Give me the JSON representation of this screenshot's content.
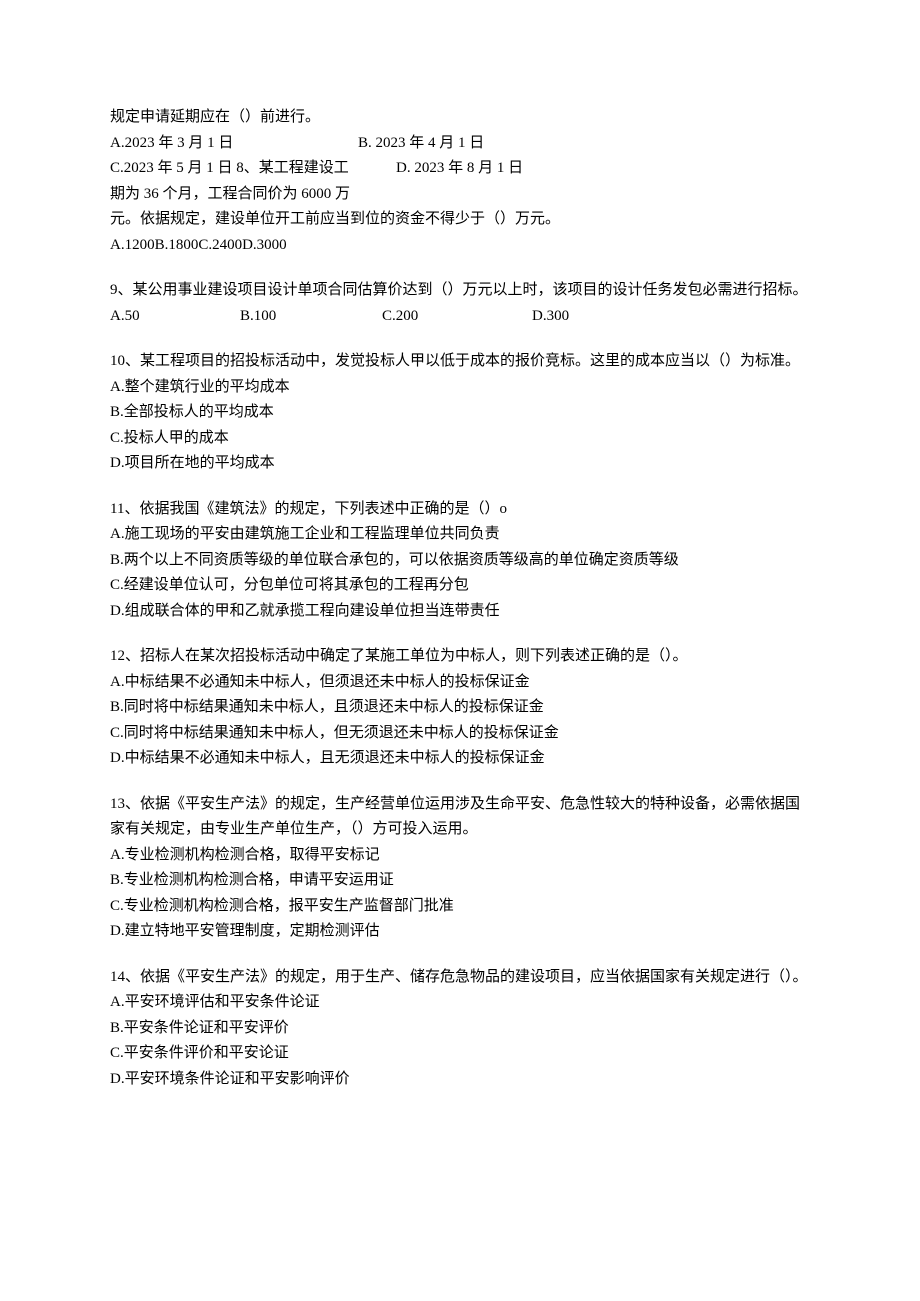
{
  "q7_tail": {
    "line1": "规定申请延期应在（）前进行。",
    "opts": {
      "a": "A.2023 年 3 月 1 日",
      "b": "B. 2023 年 4 月 1 日",
      "c": "C.2023 年 5 月 1 日 8、某工程建设工",
      "d": "D. 2023 年 8 月 1 日"
    },
    "line2": "期为 36 个月，工程合同价为 6000 万",
    "line3": "元。依据规定，建设单位开工前应当到位的资金不得少于（）万元。",
    "opts_combined": "A.1200B.1800C.2400D.3000"
  },
  "q9": {
    "stem": "9、某公用事业建设项目设计单项合同估算价达到（）万元以上时，该项目的设计任务发包必需进行招标。",
    "a": "A.50",
    "b": "B.100",
    "c": "C.200",
    "d": "D.300"
  },
  "q10": {
    "stem": "10、某工程项目的招投标活动中，发觉投标人甲以低于成本的报价竞标。这里的成本应当以（）为标准。",
    "a": "A.整个建筑行业的平均成本",
    "b": "B.全部投标人的平均成本",
    "c": "C.投标人甲的成本",
    "d": "D.项目所在地的平均成本"
  },
  "q11": {
    "stem": "11、依据我国《建筑法》的规定，下列表述中正确的是（）o",
    "a": "A.施工现场的平安由建筑施工企业和工程监理单位共同负责",
    "b": "B.两个以上不同资质等级的单位联合承包的，可以依据资质等级高的单位确定资质等级",
    "c": "C.经建设单位认可，分包单位可将其承包的工程再分包",
    "d": "D.组成联合体的甲和乙就承揽工程向建设单位担当连带责任"
  },
  "q12": {
    "stem": "12、招标人在某次招投标活动中确定了某施工单位为中标人，则下列表述正确的是（）。",
    "a": "A.中标结果不必通知未中标人，但须退还未中标人的投标保证金",
    "b": "B.同时将中标结果通知未中标人，且须退还未中标人的投标保证金",
    "c": "C.同时将中标结果通知未中标人，但无须退还未中标人的投标保证金",
    "d": "D.中标结果不必通知未中标人，且无须退还未中标人的投标保证金"
  },
  "q13": {
    "stem": "13、依据《平安生产法》的规定，生产经营单位运用涉及生命平安、危急性较大的特种设备，必需依据国家有关规定，由专业生产单位生产，（）方可投入运用。",
    "a": "A.专业检测机构检测合格，取得平安标记",
    "b": "B.专业检测机构检测合格，申请平安运用证",
    "c": "C.专业检测机构检测合格，报平安生产监督部门批准",
    "d": "D.建立特地平安管理制度，定期检测评估"
  },
  "q14": {
    "stem": "14、依据《平安生产法》的规定，用于生产、储存危急物品的建设项目，应当依据国家有关规定进行（）。",
    "a": "A.平安环境评估和平安条件论证",
    "b": "B.平安条件论证和平安评价",
    "c": "C.平安条件评价和平安论证",
    "d": "D.平安环境条件论证和平安影响评价"
  }
}
